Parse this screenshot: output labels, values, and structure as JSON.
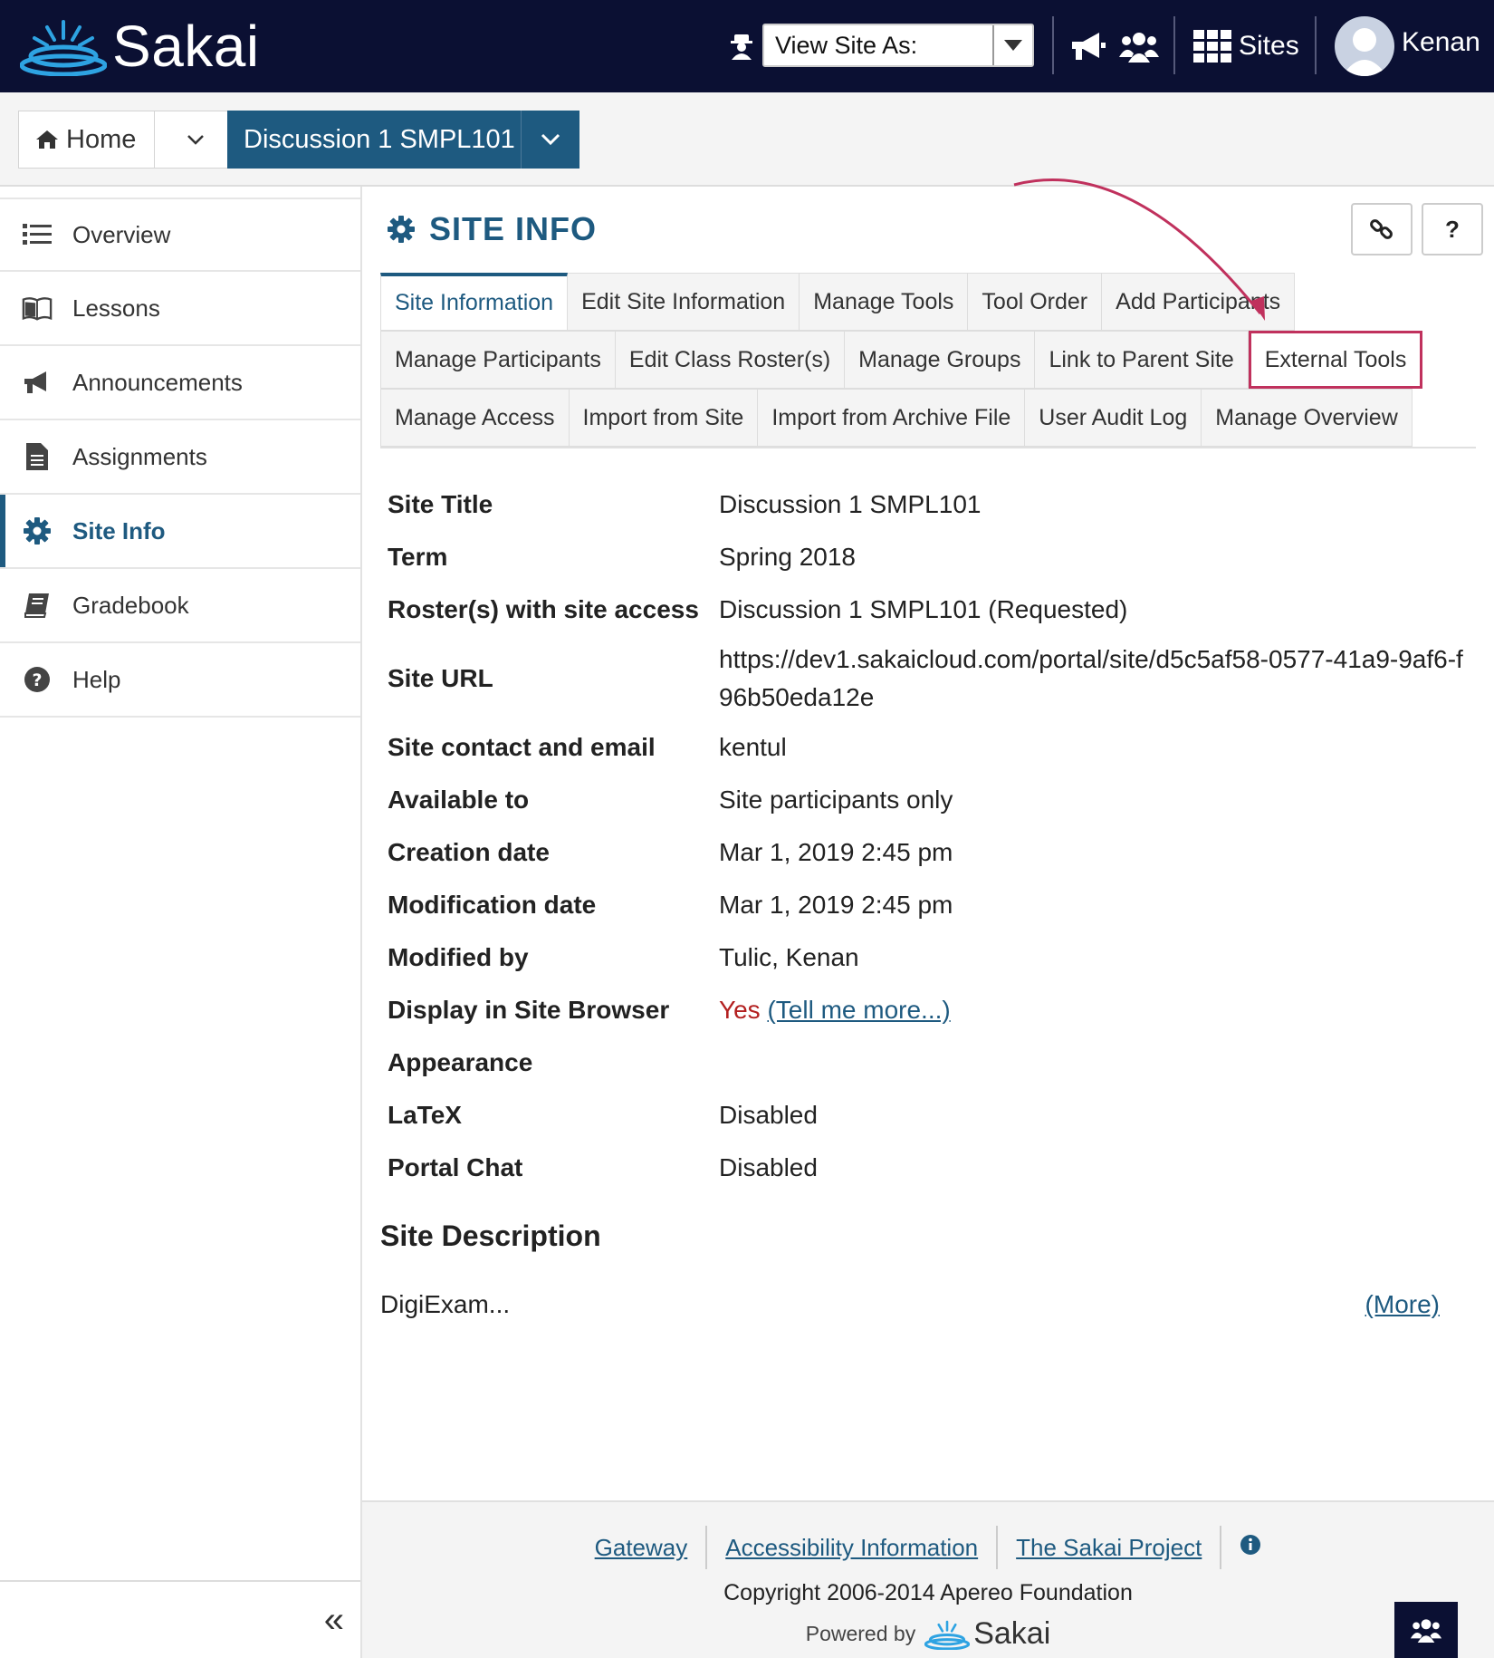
{
  "header": {
    "logo_text": "Sakai",
    "view_site_as_label": "View Site As:",
    "sites_label": "Sites",
    "user_name": "Kenan"
  },
  "sitebar": {
    "home_label": "Home",
    "site_label": "Discussion 1 SMPL101"
  },
  "sidebar": {
    "items": [
      {
        "label": "Overview",
        "icon": "list-icon"
      },
      {
        "label": "Lessons",
        "icon": "book-open-icon"
      },
      {
        "label": "Announcements",
        "icon": "megaphone-icon"
      },
      {
        "label": "Assignments",
        "icon": "file-text-icon"
      },
      {
        "label": "Site Info",
        "icon": "gear-icon",
        "active": true
      },
      {
        "label": "Gradebook",
        "icon": "book-icon"
      },
      {
        "label": "Help",
        "icon": "question-circle-icon"
      }
    ],
    "collapse_label": "«"
  },
  "main": {
    "title": "SITE INFO",
    "help_label": "?",
    "tabs": {
      "row1": [
        "Site Information",
        "Edit Site Information",
        "Manage Tools",
        "Tool Order",
        "Add Participants"
      ],
      "row2": [
        "Manage Participants",
        "Edit Class Roster(s)",
        "Manage Groups",
        "Link to Parent Site",
        "External Tools"
      ],
      "row3": [
        "Manage Access",
        "Import from Site",
        "Import from Archive File",
        "User Audit Log",
        "Manage Overview"
      ]
    },
    "info": [
      {
        "label": "Site Title",
        "value": "Discussion 1 SMPL101"
      },
      {
        "label": "Term",
        "value": "Spring 2018"
      },
      {
        "label": "Roster(s) with site access",
        "value": "Discussion 1 SMPL101 (Requested)"
      },
      {
        "label": "Site URL",
        "value": "https://dev1.sakaicloud.com/portal/site/d5c5af58-0577-41a9-9af6-f96b50eda12e"
      },
      {
        "label": "Site contact and email",
        "value": "kentul"
      },
      {
        "label": "Available to",
        "value": "Site participants only"
      },
      {
        "label": "Creation date",
        "value": "Mar 1, 2019 2:45 pm"
      },
      {
        "label": "Modification date",
        "value": "Mar 1, 2019 2:45 pm"
      },
      {
        "label": "Modified by",
        "value": "Tulic, Kenan"
      },
      {
        "label": "Display in Site Browser",
        "value": "Yes",
        "link": "(Tell me more...)"
      },
      {
        "label": "Appearance",
        "value": ""
      },
      {
        "label": "LaTeX",
        "value": "Disabled"
      },
      {
        "label": "Portal Chat",
        "value": "Disabled"
      }
    ],
    "description_title": "Site Description",
    "description_text": "DigiExam...",
    "more_link": "(More)"
  },
  "footer": {
    "links": [
      "Gateway",
      "Accessibility Information",
      "The Sakai Project"
    ],
    "copyright": "Copyright 2006-2014 Apereo Foundation",
    "powered_by": "Powered by",
    "powered_logo": "Sakai"
  },
  "colors": {
    "header_bg": "#0b1033",
    "accent": "#1e5a80",
    "highlight": "#c0315d",
    "yes_red": "#b32020"
  }
}
